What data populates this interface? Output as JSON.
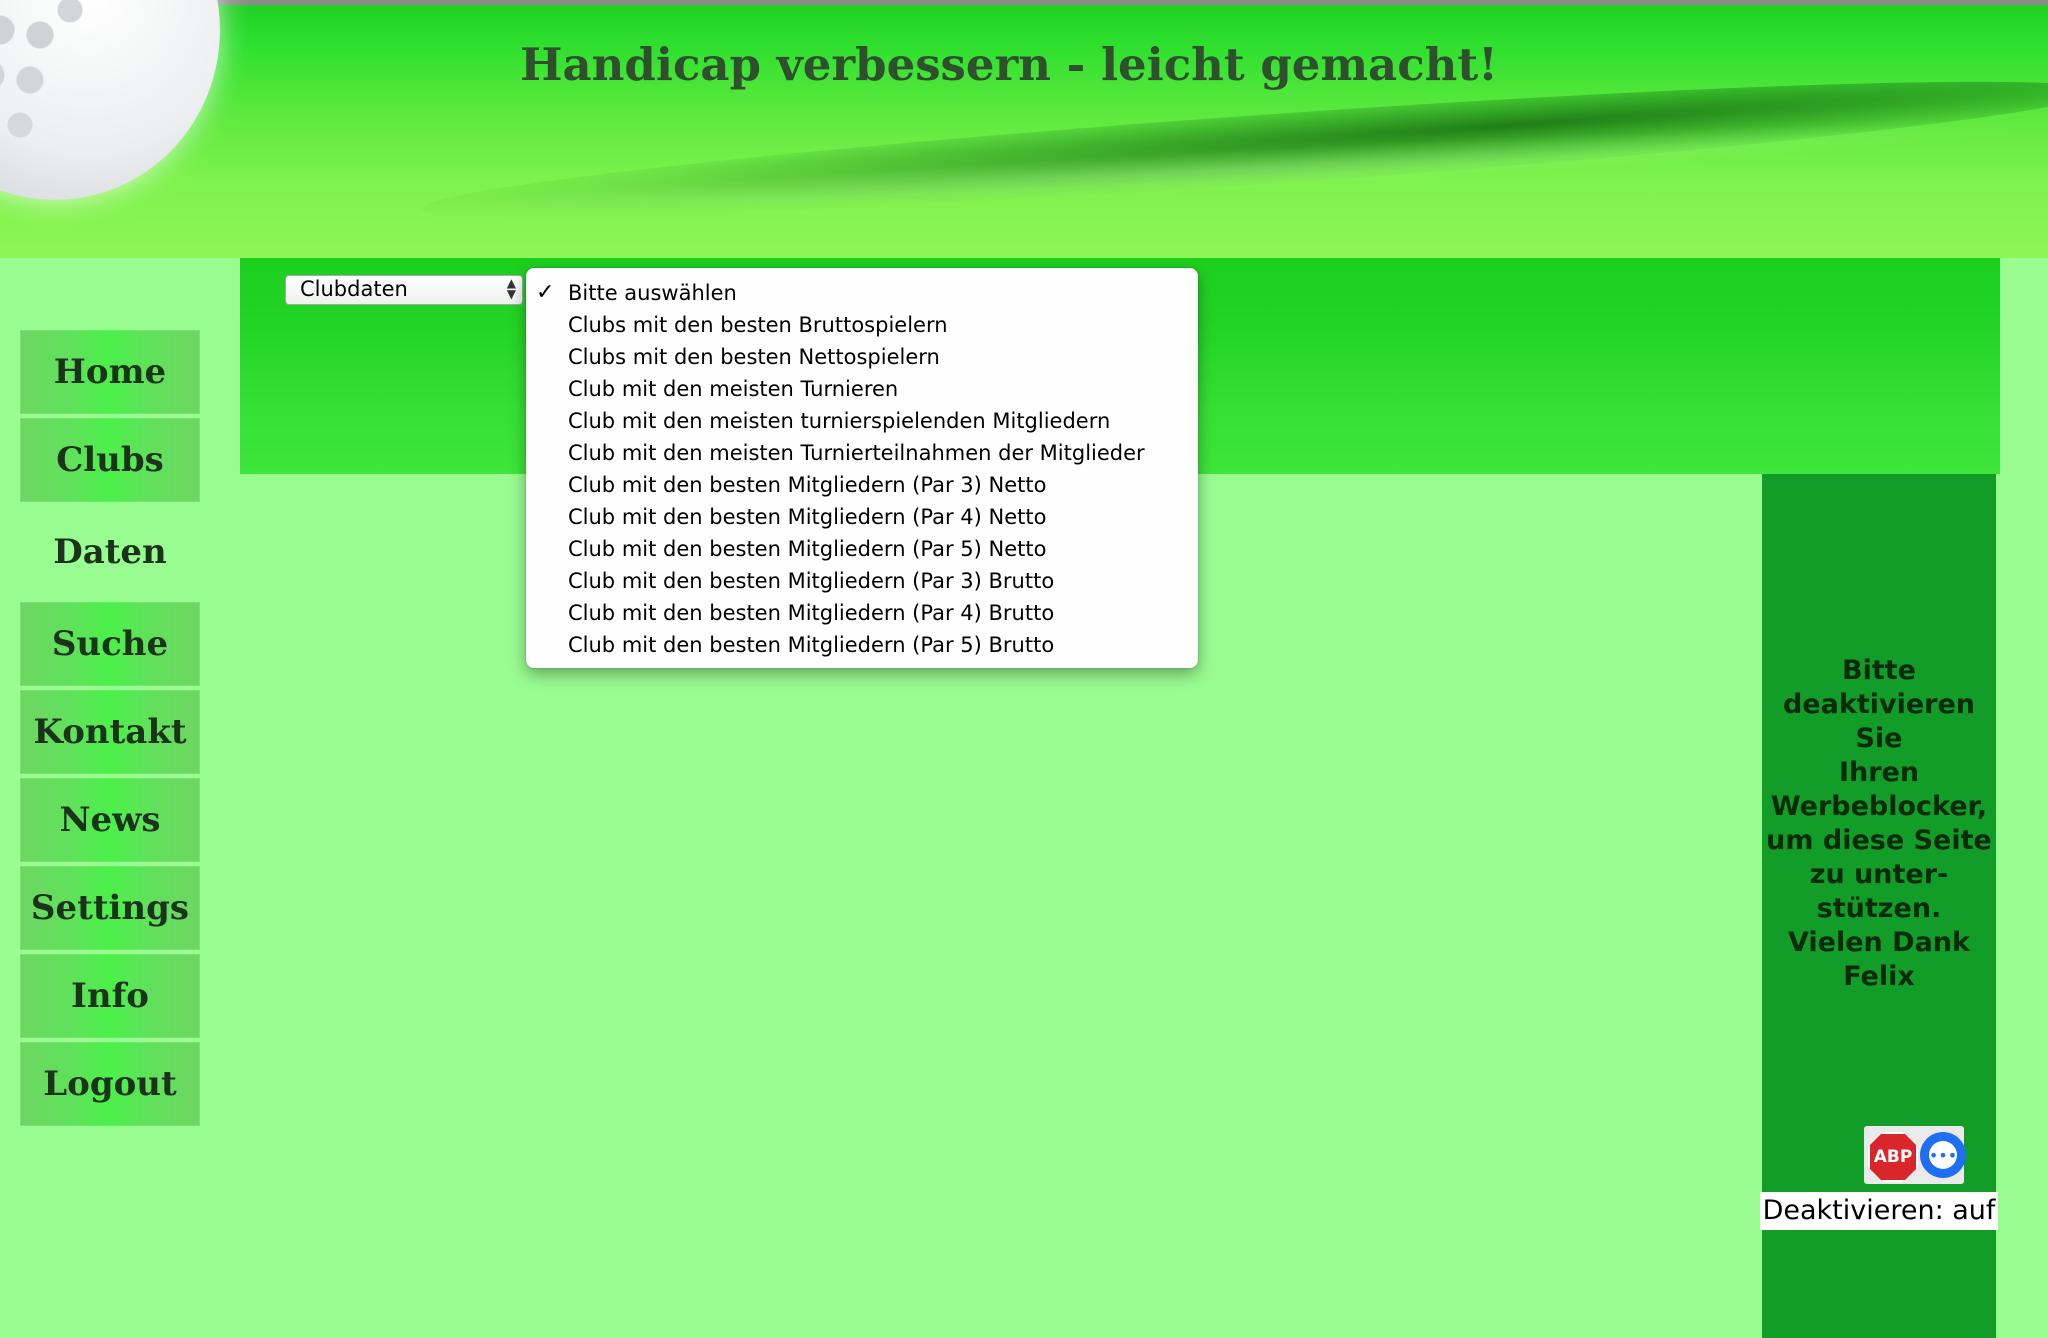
{
  "header": {
    "title": "Handicap verbessern - leicht gemacht!"
  },
  "select": {
    "value": "Clubdaten"
  },
  "dropdown": {
    "options": [
      "Bitte auswählen",
      "Clubs mit den besten Bruttospielern",
      "Clubs mit den besten Nettospielern",
      "Club mit den meisten Turnieren",
      "Club mit den meisten turnierspielenden Mitgliedern",
      "Club mit den meisten Turnierteilnahmen der Mitglieder",
      "Club mit den besten Mitgliedern (Par 3) Netto",
      "Club mit den besten Mitgliedern (Par 4) Netto",
      "Club mit den besten Mitgliedern (Par 5) Netto",
      "Club mit den besten Mitgliedern (Par 3) Brutto",
      "Club mit den besten Mitgliedern (Par 4) Brutto",
      "Club mit den besten Mitgliedern (Par 5) Brutto"
    ],
    "selected_index": 0,
    "check_mark": "✓"
  },
  "nav": {
    "items": [
      "Home",
      "Clubs",
      "Daten",
      "Suche",
      "Kontakt",
      "News",
      "Settings",
      "Info",
      "Logout"
    ],
    "active": "Daten"
  },
  "ad": {
    "lines": [
      "Bitte",
      "deaktivieren Sie",
      "Ihren",
      "Werbeblocker,",
      "um diese Seite",
      "zu unter-",
      "stützen."
    ],
    "thanks": "Vielen Dank",
    "signature": "Felix",
    "abp_label": "ABP",
    "deactivate": "Deaktivieren: auf"
  },
  "colors": {
    "page_bg": "#99fc91",
    "ad_column": "#129c28",
    "nav_button": "#5fe25a"
  }
}
